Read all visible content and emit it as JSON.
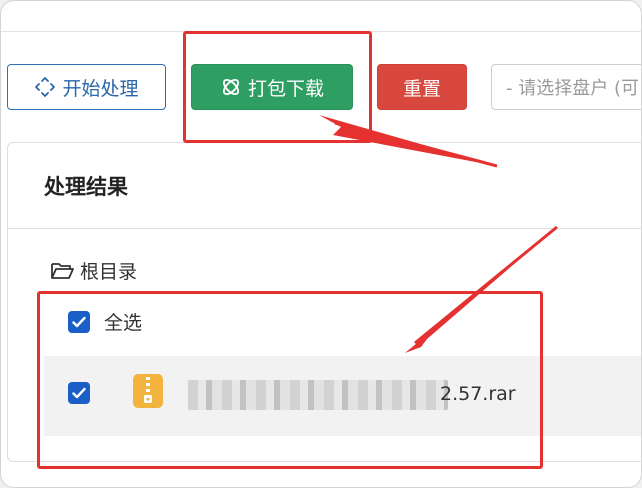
{
  "toolbar": {
    "start_label": "开始处理",
    "pack_download_label": "打包下载",
    "reset_label": "重置",
    "disk_select_placeholder": "- 请选择盘户 (可"
  },
  "panel": {
    "title": "处理结果",
    "root_label": "根目录",
    "select_all_label": "全选",
    "file": {
      "name_visible": "2.57.rar",
      "checked": true
    },
    "select_all_checked": true
  },
  "icons": {
    "start": "move-arrows-icon",
    "pack": "package-icon",
    "root": "folder-open-icon",
    "file": "zip-file-icon",
    "check": "checkmark-icon"
  },
  "colors": {
    "primary_outline": "#2f6fb4",
    "success": "#2f9e62",
    "danger": "#d9483f",
    "checkbox": "#1a5fc7",
    "annotation": "#e5312f",
    "zip_icon": "#f3b43f"
  }
}
